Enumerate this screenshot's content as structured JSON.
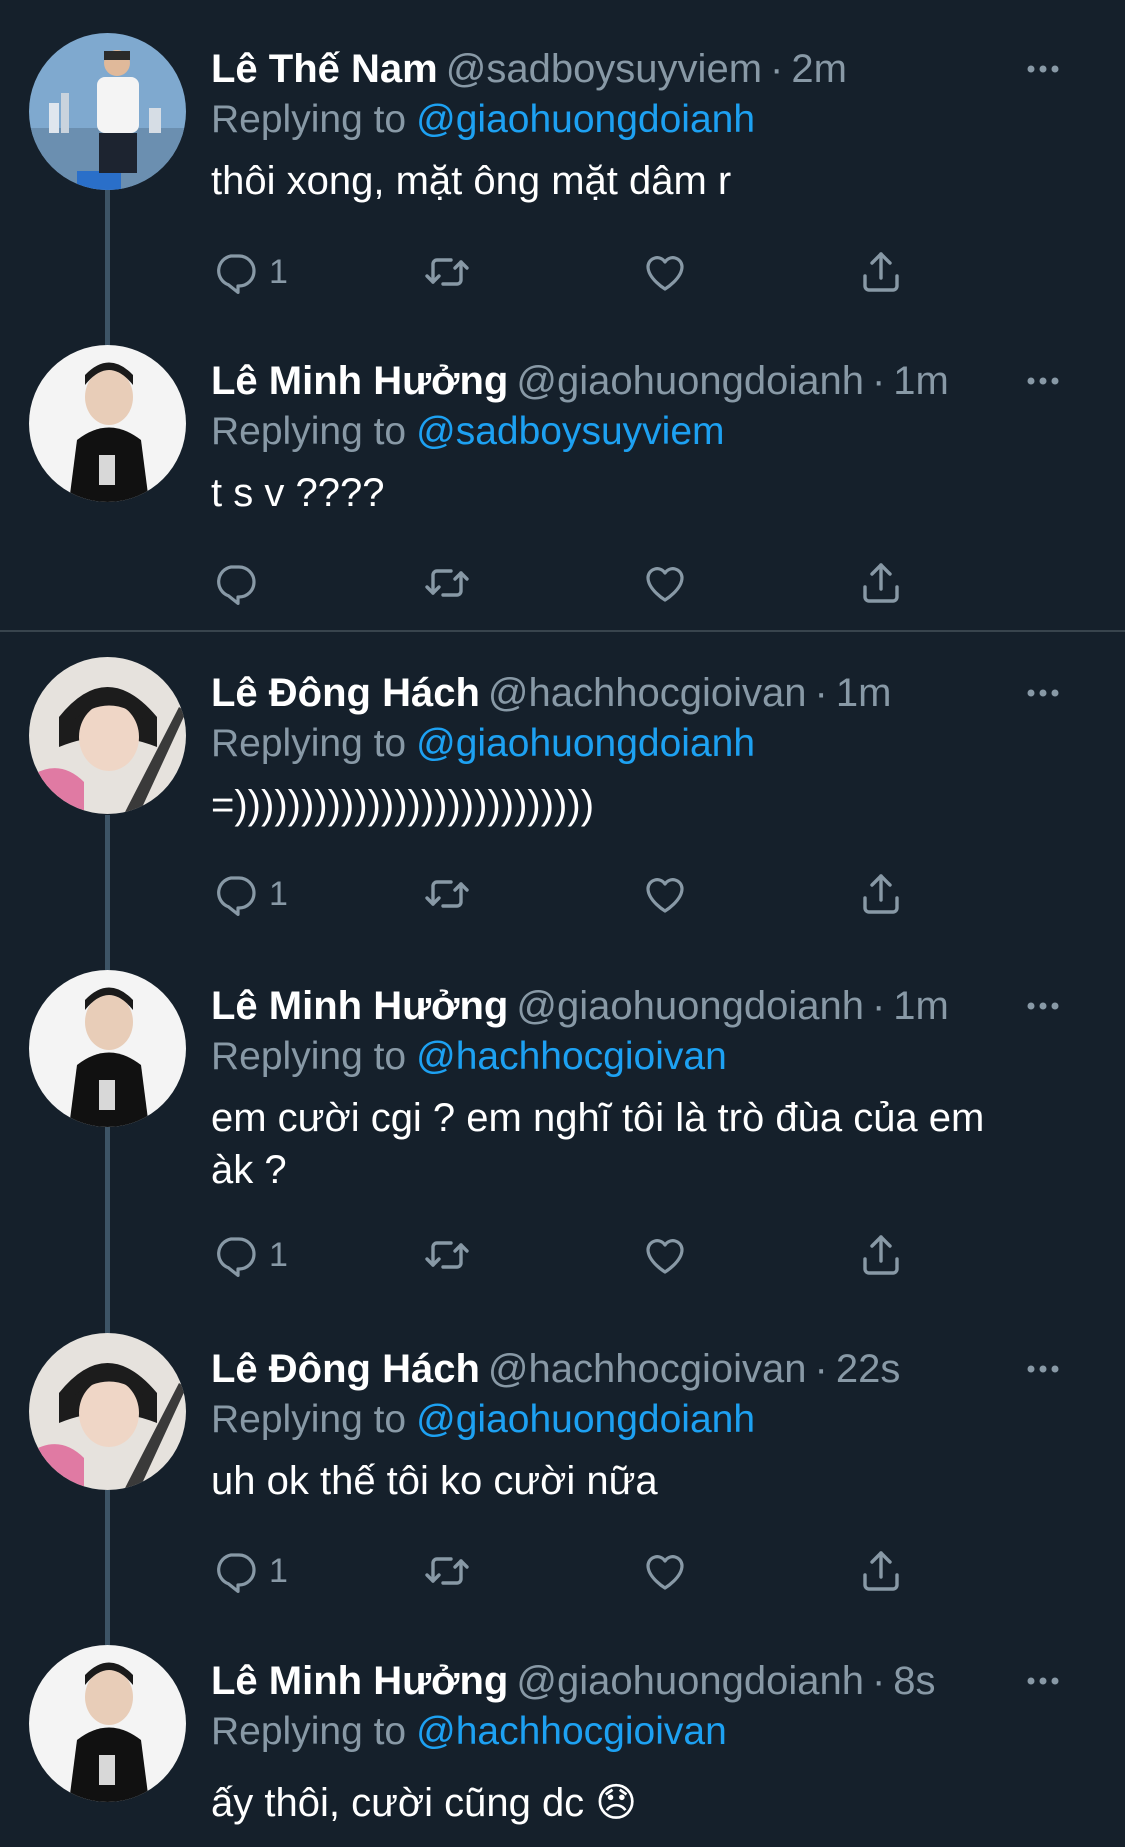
{
  "tweets": [
    {
      "name": "Lê Thế Nam",
      "handle": "@sadboysuyviem",
      "dot": "·",
      "time": "2m",
      "replying_label": "Replying to",
      "replying_to": "@giaohuongdoianh",
      "text": "thôi xong, mặt ông mặt dâm r",
      "reply_count": "1"
    },
    {
      "name": "Lê Minh Hưởng",
      "handle": "@giaohuongdoianh",
      "dot": "·",
      "time": "1m",
      "replying_label": "Replying to",
      "replying_to": "@sadboysuyviem",
      "text": "t s v ????",
      "reply_count": ""
    },
    {
      "name": "Lê Đông Hách",
      "handle": "@hachhocgioivan",
      "dot": "·",
      "time": "1m",
      "replying_label": "Replying to",
      "replying_to": "@giaohuongdoianh",
      "text": "=)))))))))))))))))))))))))))",
      "reply_count": "1"
    },
    {
      "name": "Lê Minh Hưởng",
      "handle": "@giaohuongdoianh",
      "dot": "·",
      "time": "1m",
      "replying_label": "Replying to",
      "replying_to": "@hachhocgioivan",
      "text": "em cười cgi ? em nghĩ tôi là trò đùa của em àk ?",
      "reply_count": "1"
    },
    {
      "name": "Lê Đông Hách",
      "handle": "@hachhocgioivan",
      "dot": "·",
      "time": "22s",
      "replying_label": "Replying to",
      "replying_to": "@giaohuongdoianh",
      "text": "uh ok thế tôi ko cười nữa",
      "reply_count": "1"
    },
    {
      "name": "Lê Minh Hưởng",
      "handle": "@giaohuongdoianh",
      "dot": "·",
      "time": "8s",
      "replying_label": "Replying to",
      "replying_to": "@hachhocgioivan",
      "text": "ấy thôi, cười cũng dc 😞",
      "reply_count": ""
    }
  ],
  "colors": {
    "background": "#15202b",
    "secondary_text": "#8899a6",
    "link": "#1da1f2",
    "thread_line": "#3d5466",
    "separator": "#38444d"
  },
  "icons": [
    "reply-icon",
    "retweet-icon",
    "like-icon",
    "share-icon",
    "more-icon"
  ]
}
